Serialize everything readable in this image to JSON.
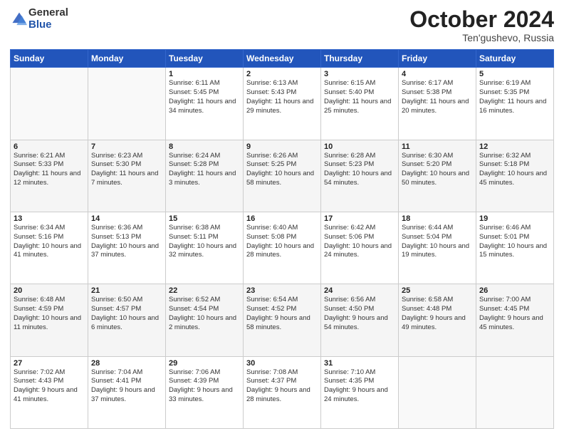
{
  "logo": {
    "general": "General",
    "blue": "Blue"
  },
  "title": "October 2024",
  "location": "Ten'gushevo, Russia",
  "days_header": [
    "Sunday",
    "Monday",
    "Tuesday",
    "Wednesday",
    "Thursday",
    "Friday",
    "Saturday"
  ],
  "weeks": [
    [
      {
        "day": "",
        "sunrise": "",
        "sunset": "",
        "daylight": ""
      },
      {
        "day": "",
        "sunrise": "",
        "sunset": "",
        "daylight": ""
      },
      {
        "day": "1",
        "sunrise": "Sunrise: 6:11 AM",
        "sunset": "Sunset: 5:45 PM",
        "daylight": "Daylight: 11 hours and 34 minutes."
      },
      {
        "day": "2",
        "sunrise": "Sunrise: 6:13 AM",
        "sunset": "Sunset: 5:43 PM",
        "daylight": "Daylight: 11 hours and 29 minutes."
      },
      {
        "day": "3",
        "sunrise": "Sunrise: 6:15 AM",
        "sunset": "Sunset: 5:40 PM",
        "daylight": "Daylight: 11 hours and 25 minutes."
      },
      {
        "day": "4",
        "sunrise": "Sunrise: 6:17 AM",
        "sunset": "Sunset: 5:38 PM",
        "daylight": "Daylight: 11 hours and 20 minutes."
      },
      {
        "day": "5",
        "sunrise": "Sunrise: 6:19 AM",
        "sunset": "Sunset: 5:35 PM",
        "daylight": "Daylight: 11 hours and 16 minutes."
      }
    ],
    [
      {
        "day": "6",
        "sunrise": "Sunrise: 6:21 AM",
        "sunset": "Sunset: 5:33 PM",
        "daylight": "Daylight: 11 hours and 12 minutes."
      },
      {
        "day": "7",
        "sunrise": "Sunrise: 6:23 AM",
        "sunset": "Sunset: 5:30 PM",
        "daylight": "Daylight: 11 hours and 7 minutes."
      },
      {
        "day": "8",
        "sunrise": "Sunrise: 6:24 AM",
        "sunset": "Sunset: 5:28 PM",
        "daylight": "Daylight: 11 hours and 3 minutes."
      },
      {
        "day": "9",
        "sunrise": "Sunrise: 6:26 AM",
        "sunset": "Sunset: 5:25 PM",
        "daylight": "Daylight: 10 hours and 58 minutes."
      },
      {
        "day": "10",
        "sunrise": "Sunrise: 6:28 AM",
        "sunset": "Sunset: 5:23 PM",
        "daylight": "Daylight: 10 hours and 54 minutes."
      },
      {
        "day": "11",
        "sunrise": "Sunrise: 6:30 AM",
        "sunset": "Sunset: 5:20 PM",
        "daylight": "Daylight: 10 hours and 50 minutes."
      },
      {
        "day": "12",
        "sunrise": "Sunrise: 6:32 AM",
        "sunset": "Sunset: 5:18 PM",
        "daylight": "Daylight: 10 hours and 45 minutes."
      }
    ],
    [
      {
        "day": "13",
        "sunrise": "Sunrise: 6:34 AM",
        "sunset": "Sunset: 5:16 PM",
        "daylight": "Daylight: 10 hours and 41 minutes."
      },
      {
        "day": "14",
        "sunrise": "Sunrise: 6:36 AM",
        "sunset": "Sunset: 5:13 PM",
        "daylight": "Daylight: 10 hours and 37 minutes."
      },
      {
        "day": "15",
        "sunrise": "Sunrise: 6:38 AM",
        "sunset": "Sunset: 5:11 PM",
        "daylight": "Daylight: 10 hours and 32 minutes."
      },
      {
        "day": "16",
        "sunrise": "Sunrise: 6:40 AM",
        "sunset": "Sunset: 5:08 PM",
        "daylight": "Daylight: 10 hours and 28 minutes."
      },
      {
        "day": "17",
        "sunrise": "Sunrise: 6:42 AM",
        "sunset": "Sunset: 5:06 PM",
        "daylight": "Daylight: 10 hours and 24 minutes."
      },
      {
        "day": "18",
        "sunrise": "Sunrise: 6:44 AM",
        "sunset": "Sunset: 5:04 PM",
        "daylight": "Daylight: 10 hours and 19 minutes."
      },
      {
        "day": "19",
        "sunrise": "Sunrise: 6:46 AM",
        "sunset": "Sunset: 5:01 PM",
        "daylight": "Daylight: 10 hours and 15 minutes."
      }
    ],
    [
      {
        "day": "20",
        "sunrise": "Sunrise: 6:48 AM",
        "sunset": "Sunset: 4:59 PM",
        "daylight": "Daylight: 10 hours and 11 minutes."
      },
      {
        "day": "21",
        "sunrise": "Sunrise: 6:50 AM",
        "sunset": "Sunset: 4:57 PM",
        "daylight": "Daylight: 10 hours and 6 minutes."
      },
      {
        "day": "22",
        "sunrise": "Sunrise: 6:52 AM",
        "sunset": "Sunset: 4:54 PM",
        "daylight": "Daylight: 10 hours and 2 minutes."
      },
      {
        "day": "23",
        "sunrise": "Sunrise: 6:54 AM",
        "sunset": "Sunset: 4:52 PM",
        "daylight": "Daylight: 9 hours and 58 minutes."
      },
      {
        "day": "24",
        "sunrise": "Sunrise: 6:56 AM",
        "sunset": "Sunset: 4:50 PM",
        "daylight": "Daylight: 9 hours and 54 minutes."
      },
      {
        "day": "25",
        "sunrise": "Sunrise: 6:58 AM",
        "sunset": "Sunset: 4:48 PM",
        "daylight": "Daylight: 9 hours and 49 minutes."
      },
      {
        "day": "26",
        "sunrise": "Sunrise: 7:00 AM",
        "sunset": "Sunset: 4:45 PM",
        "daylight": "Daylight: 9 hours and 45 minutes."
      }
    ],
    [
      {
        "day": "27",
        "sunrise": "Sunrise: 7:02 AM",
        "sunset": "Sunset: 4:43 PM",
        "daylight": "Daylight: 9 hours and 41 minutes."
      },
      {
        "day": "28",
        "sunrise": "Sunrise: 7:04 AM",
        "sunset": "Sunset: 4:41 PM",
        "daylight": "Daylight: 9 hours and 37 minutes."
      },
      {
        "day": "29",
        "sunrise": "Sunrise: 7:06 AM",
        "sunset": "Sunset: 4:39 PM",
        "daylight": "Daylight: 9 hours and 33 minutes."
      },
      {
        "day": "30",
        "sunrise": "Sunrise: 7:08 AM",
        "sunset": "Sunset: 4:37 PM",
        "daylight": "Daylight: 9 hours and 28 minutes."
      },
      {
        "day": "31",
        "sunrise": "Sunrise: 7:10 AM",
        "sunset": "Sunset: 4:35 PM",
        "daylight": "Daylight: 9 hours and 24 minutes."
      },
      {
        "day": "",
        "sunrise": "",
        "sunset": "",
        "daylight": ""
      },
      {
        "day": "",
        "sunrise": "",
        "sunset": "",
        "daylight": ""
      }
    ]
  ]
}
